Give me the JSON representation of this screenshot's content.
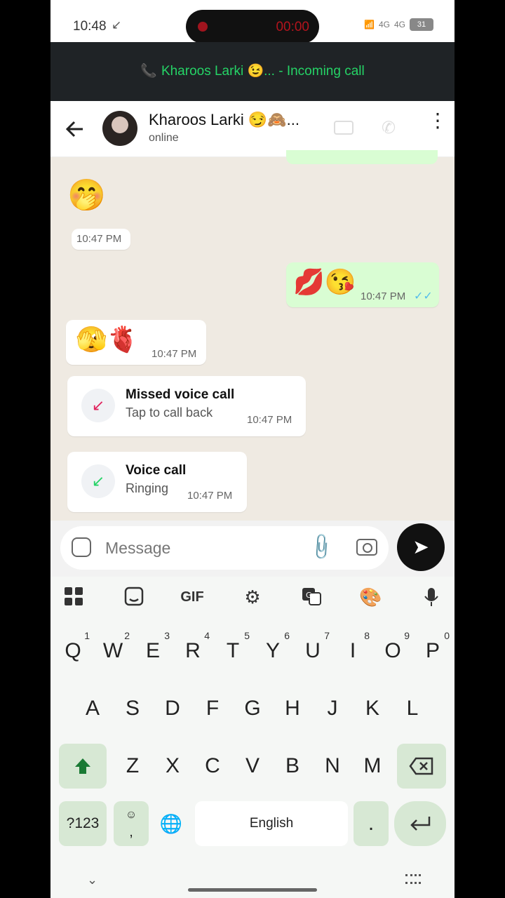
{
  "status_bar": {
    "time": "10:48",
    "time_icon": "↙",
    "recording_timer": "00:00",
    "network": [
      "4G",
      "4G"
    ],
    "battery": "31"
  },
  "call_banner": {
    "text": "Kharoos Larki 😉... - Incoming call",
    "phone_glyph": "📞"
  },
  "header": {
    "contact_name": "Kharoos Larki 😏🙈...",
    "status": "online",
    "icons": [
      "back-arrow-icon",
      "video-call-icon",
      "voice-call-icon",
      "more-menu-icon"
    ]
  },
  "messages": [
    {
      "dir": "in",
      "emoji": "🤭",
      "time": "10:47 PM"
    },
    {
      "dir": "out",
      "emoji": "💋😘",
      "time": "10:47 PM",
      "ticks": "✓✓"
    },
    {
      "dir": "in",
      "emoji": "🫣🫀",
      "time": "10:47 PM"
    },
    {
      "dir": "in",
      "type": "call",
      "title": "Missed voice call",
      "subtitle": "Tap to call back",
      "time": "10:47 PM",
      "icon": "missed-call-icon"
    },
    {
      "dir": "in",
      "type": "call",
      "title": "Voice call",
      "subtitle": "Ringing",
      "time": "10:47 PM",
      "icon": "incoming-call-icon"
    }
  ],
  "composer": {
    "placeholder": "Message",
    "send_glyph": "➤"
  },
  "keyboard": {
    "toolbar": {
      "gif": "GIF"
    },
    "row1": [
      {
        "k": "Q",
        "n": "1"
      },
      {
        "k": "W",
        "n": "2"
      },
      {
        "k": "E",
        "n": "3"
      },
      {
        "k": "R",
        "n": "4"
      },
      {
        "k": "T",
        "n": "5"
      },
      {
        "k": "Y",
        "n": "6"
      },
      {
        "k": "U",
        "n": "7"
      },
      {
        "k": "I",
        "n": "8"
      },
      {
        "k": "O",
        "n": "9"
      },
      {
        "k": "P",
        "n": "0"
      }
    ],
    "row2": [
      "A",
      "S",
      "D",
      "F",
      "G",
      "H",
      "J",
      "K",
      "L"
    ],
    "row3": [
      "Z",
      "X",
      "C",
      "V",
      "B",
      "N",
      "M"
    ],
    "symbols": "?123",
    "emoji_comma": ",",
    "space": "English",
    "period": "."
  },
  "colors": {
    "accent": "#25d366",
    "chat_bg": "#efeae2",
    "outgoing_bubble": "#d9fdd3",
    "missed_call": "#e0245e",
    "read_ticks": "#53bdeb"
  }
}
